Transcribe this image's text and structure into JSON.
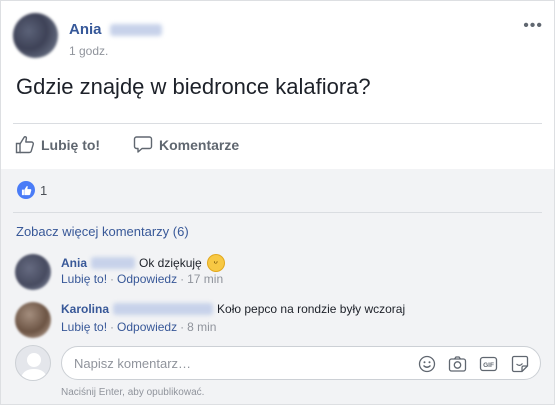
{
  "post": {
    "author": "Ania",
    "time": "1 godz.",
    "more_label": "•••",
    "text": "Gdzie znajdę w biedronce kalafiora?"
  },
  "actions": {
    "like_label": "Lubię to!",
    "comment_label": "Komentarze"
  },
  "reactions": {
    "count": "1"
  },
  "comments": {
    "more_label": "Zobacz więcej komentarzy (6)",
    "items": [
      {
        "author": "Ania",
        "text": "Ok dziękuję",
        "like_label": "Lubię to!",
        "reply_label": "Odpowiedz",
        "time": "17 min"
      },
      {
        "author": "Karolina",
        "text": "Koło pepco na rondzie były wczoraj",
        "like_label": "Lubię to!",
        "reply_label": "Odpowiedz",
        "time": "8 min"
      }
    ]
  },
  "composer": {
    "placeholder": "Napisz komentarz…",
    "hint": "Naciśnij Enter, aby opublikować.",
    "icons": [
      "emoji-icon",
      "camera-icon",
      "gif-icon",
      "sticker-icon"
    ]
  },
  "colors": {
    "link": "#385898",
    "like_badge": "#4a7cf7"
  }
}
